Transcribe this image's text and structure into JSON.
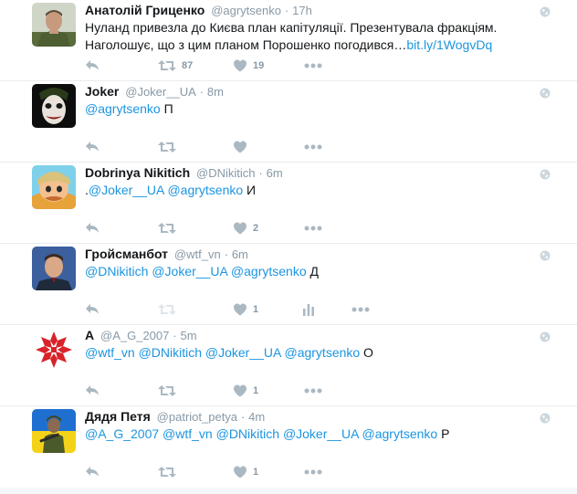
{
  "tweets": [
    {
      "name": "Анатолій Гриценко",
      "handle": "@agrytsenko",
      "dot": "·",
      "time": "17h",
      "text_plain": "Нуланд привезла до Києва план капітуляції. Презентувала фракціям. Наголошує, що з цим планом Порошенко погодився…",
      "text_link": "bit.ly/1WogvDq",
      "retweets": "87",
      "likes": "19",
      "avatar": "man-in-military-uniform"
    },
    {
      "name": "Joker",
      "handle": "@Joker__UA",
      "dot": "·",
      "time": "8m",
      "mentions": "@agrytsenko",
      "text_tail": " П",
      "retweets": "",
      "likes": "",
      "avatar": "joker-face"
    },
    {
      "name": "Dobrinya Nikitich",
      "handle": "@DNikitich",
      "dot": "·",
      "time": "6m",
      "prefix": ".",
      "mentions": "@Joker__UA @agrytsenko",
      "text_tail": " И",
      "retweets": "",
      "likes": "2",
      "avatar": "cartoon-knight"
    },
    {
      "name": "Гройсманбот",
      "handle": "@wtf_vn",
      "dot": "·",
      "time": "6m",
      "mentions": "@DNikitich @Joker__UA @agrytsenko",
      "text_tail": " Д",
      "retweets": "",
      "likes": "1",
      "has_stats": true,
      "avatar": "man-portrait"
    },
    {
      "name": "А",
      "handle": "@A_G_2007",
      "dot": "·",
      "time": "5m",
      "mentions": "@wtf_vn @DNikitich @Joker__UA @agrytsenko",
      "text_tail": " О",
      "retweets": "",
      "likes": "1",
      "avatar": "red-star-ornament"
    },
    {
      "name": "Дядя Петя",
      "handle": "@patriot_petya",
      "dot": "·",
      "time": "4m",
      "mentions": "@A_G_2007 @wtf_vn @DNikitich @Joker__UA @agrytsenko",
      "text_tail": " Р",
      "retweets": "",
      "likes": "1",
      "avatar": "soldier-ukrainian-flag"
    }
  ],
  "colors": {
    "link": "#1b95e0",
    "icon": "#aab8c2",
    "muted": "#8899a6",
    "divider": "#e6ecf0"
  },
  "icons": [
    "reply-icon",
    "retweet-icon",
    "like-icon",
    "more-icon",
    "globe-icon",
    "stats-icon"
  ]
}
